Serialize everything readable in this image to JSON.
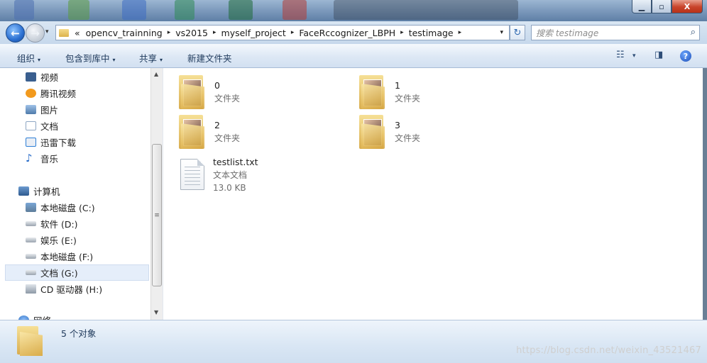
{
  "window": {
    "min_label": "▁",
    "max_label": "▫",
    "close_label": "X"
  },
  "nav": {
    "back_glyph": "←",
    "forward_glyph": "→",
    "history_glyph": "▾"
  },
  "address": {
    "overflow_glyph": "«",
    "crumbs": [
      "opencv_trainning",
      "vs2015",
      "myself_project",
      "FaceRccognizer_LBPH",
      "testimage"
    ],
    "separator": "▸",
    "drop_glyph": "▾",
    "refresh_glyph": "↻"
  },
  "search": {
    "placeholder": "搜索 testimage",
    "icon": "search-icon"
  },
  "toolbar": {
    "organize": "组织",
    "include_library": "包含到库中",
    "share": "共享",
    "new_folder": "新建文件夹",
    "caret": "▾",
    "help_glyph": "?"
  },
  "sidebar": {
    "items": [
      {
        "label": "视频",
        "icon": "video-icon",
        "color": "#3a5f8f"
      },
      {
        "label": "腾讯视频",
        "icon": "tencent-video-icon",
        "color": "#f29a1e"
      },
      {
        "label": "图片",
        "icon": "pictures-icon",
        "color": "#5f87b8"
      },
      {
        "label": "文档",
        "icon": "documents-icon",
        "color": "#8fa7c4"
      },
      {
        "label": "迅雷下载",
        "icon": "thunder-download-icon",
        "color": "#2d7fd6"
      },
      {
        "label": "音乐",
        "icon": "music-icon",
        "color": "#2a6dc9"
      },
      {
        "label": "计算机",
        "icon": "computer-icon",
        "color": "#4b6f99"
      },
      {
        "label": "本地磁盘 (C:)",
        "icon": "system-drive-icon",
        "color": "#6b8aab"
      },
      {
        "label": "软件 (D:)",
        "icon": "drive-icon",
        "color": "#8d99a6"
      },
      {
        "label": "娱乐 (E:)",
        "icon": "drive-icon",
        "color": "#8d99a6"
      },
      {
        "label": "本地磁盘 (F:)",
        "icon": "drive-icon",
        "color": "#8d99a6"
      },
      {
        "label": "文档 (G:)",
        "icon": "drive-icon",
        "color": "#8d99a6"
      },
      {
        "label": "CD 驱动器 (H:)",
        "icon": "cd-drive-icon",
        "color": "#8d99a6"
      },
      {
        "label": "网络",
        "icon": "network-icon",
        "color": "#3b79c4"
      }
    ],
    "selected_index": 11
  },
  "scrollbar": {
    "up": "▲",
    "down": "▼",
    "grip": "≡"
  },
  "files": [
    {
      "name": "0",
      "type": "文件夹",
      "kind": "folder"
    },
    {
      "name": "1",
      "type": "文件夹",
      "kind": "folder"
    },
    {
      "name": "2",
      "type": "文件夹",
      "kind": "folder"
    },
    {
      "name": "3",
      "type": "文件夹",
      "kind": "folder"
    },
    {
      "name": "testlist.txt",
      "type": "文本文档",
      "size": "13.0 KB",
      "kind": "text"
    }
  ],
  "status": {
    "count": "5 个对象"
  },
  "watermark": "https://blog.csdn.net/weixin_43521467"
}
